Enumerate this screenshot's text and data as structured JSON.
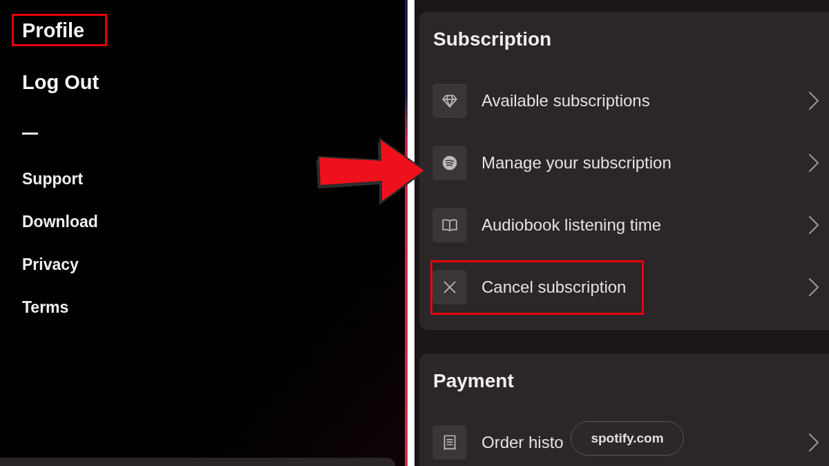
{
  "sidebar": {
    "items": [
      {
        "label": "Profile",
        "highlighted": true
      },
      {
        "label": "Log Out",
        "highlighted": false
      }
    ],
    "links": [
      "Support",
      "Download",
      "Privacy",
      "Terms"
    ]
  },
  "sections": [
    {
      "title": "Subscription",
      "rows": [
        {
          "label": "Available subscriptions",
          "highlighted": false
        },
        {
          "label": "Manage your subscription",
          "highlighted": false
        },
        {
          "label": "Audiobook listening time",
          "highlighted": false
        },
        {
          "label": "Cancel subscription",
          "highlighted": true
        }
      ]
    },
    {
      "title": "Payment",
      "rows": [
        {
          "label": "Order histo",
          "highlighted": false
        }
      ]
    }
  ],
  "overlay": {
    "url": "spotify.com"
  }
}
